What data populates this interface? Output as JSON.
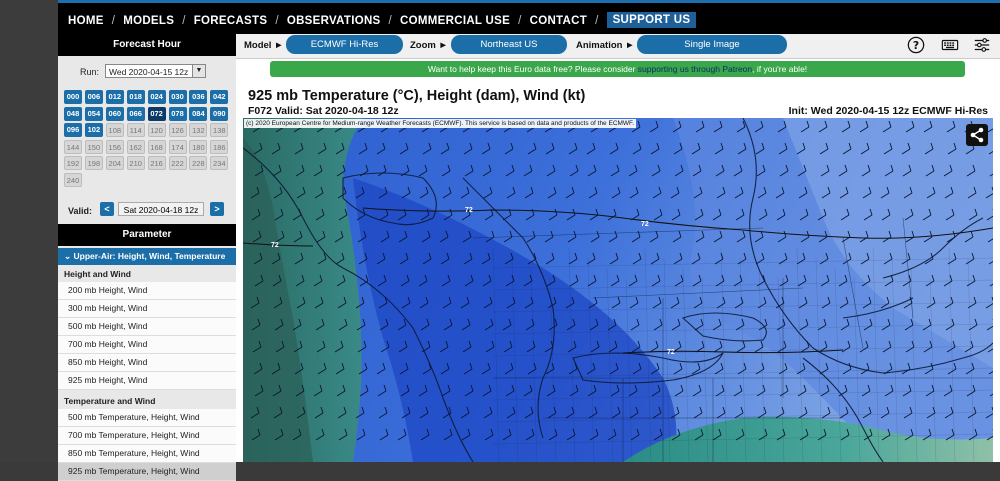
{
  "nav": {
    "items": [
      {
        "label": "HOME"
      },
      {
        "label": "MODELS"
      },
      {
        "label": "FORECASTS"
      },
      {
        "label": "OBSERVATIONS"
      },
      {
        "label": "COMMERCIAL USE"
      },
      {
        "label": "CONTACT"
      },
      {
        "label": "SUPPORT US",
        "active": true
      }
    ]
  },
  "sidebar": {
    "forecast_hour_title": "Forecast Hour",
    "run_label": "Run:",
    "run_value": "Wed 2020-04-15 12z",
    "hours": [
      {
        "h": "000",
        "s": "avail"
      },
      {
        "h": "006",
        "s": "avail"
      },
      {
        "h": "012",
        "s": "avail"
      },
      {
        "h": "018",
        "s": "avail"
      },
      {
        "h": "024",
        "s": "avail"
      },
      {
        "h": "030",
        "s": "avail"
      },
      {
        "h": "036",
        "s": "avail"
      },
      {
        "h": "042",
        "s": "avail"
      },
      {
        "h": "048",
        "s": "avail"
      },
      {
        "h": "054",
        "s": "avail"
      },
      {
        "h": "060",
        "s": "avail"
      },
      {
        "h": "066",
        "s": "avail"
      },
      {
        "h": "072",
        "s": "sel"
      },
      {
        "h": "078",
        "s": "avail"
      },
      {
        "h": "084",
        "s": "avail"
      },
      {
        "h": "090",
        "s": "avail"
      },
      {
        "h": "096",
        "s": "avail"
      },
      {
        "h": "102",
        "s": "avail"
      },
      {
        "h": "108",
        "s": "dis"
      },
      {
        "h": "114",
        "s": "dis"
      },
      {
        "h": "120",
        "s": "dis"
      },
      {
        "h": "126",
        "s": "dis"
      },
      {
        "h": "132",
        "s": "dis"
      },
      {
        "h": "138",
        "s": "dis"
      },
      {
        "h": "144",
        "s": "dis"
      },
      {
        "h": "150",
        "s": "dis"
      },
      {
        "h": "156",
        "s": "dis"
      },
      {
        "h": "162",
        "s": "dis"
      },
      {
        "h": "168",
        "s": "dis"
      },
      {
        "h": "174",
        "s": "dis"
      },
      {
        "h": "180",
        "s": "dis"
      },
      {
        "h": "186",
        "s": "dis"
      },
      {
        "h": "192",
        "s": "dis"
      },
      {
        "h": "198",
        "s": "dis"
      },
      {
        "h": "204",
        "s": "dis"
      },
      {
        "h": "210",
        "s": "dis"
      },
      {
        "h": "216",
        "s": "dis"
      },
      {
        "h": "222",
        "s": "dis"
      },
      {
        "h": "228",
        "s": "dis"
      },
      {
        "h": "234",
        "s": "dis"
      },
      {
        "h": "240",
        "s": "dis"
      }
    ],
    "valid_label": "Valid:",
    "prev_label": "<",
    "next_label": ">",
    "valid_value": "Sat 2020-04-18 12z",
    "parameter_title": "Parameter",
    "selected_category": "Upper-Air: Height, Wind, Temperature",
    "groups": [
      {
        "title": "Height and Wind",
        "items": [
          "200 mb Height, Wind",
          "300 mb Height, Wind",
          "500 mb Height, Wind",
          "700 mb Height, Wind",
          "850 mb Height, Wind",
          "925 mb Height, Wind"
        ]
      },
      {
        "title": "Temperature and Wind",
        "items": [
          "500 mb Temperature, Height, Wind",
          "700 mb Temperature, Height, Wind",
          "850 mb Temperature, Height, Wind",
          "925 mb Temperature, Height, Wind"
        ]
      }
    ],
    "current_item": "925 mb Temperature, Height, Wind"
  },
  "toolbar": {
    "model_label": "Model ►",
    "model_value": "ECMWF Hi-Res",
    "zoom_label": "Zoom ►",
    "zoom_value": "Northeast US",
    "animation_label": "Animation ►",
    "animation_value": "Single Image",
    "icons": [
      "help-icon",
      "keyboard-icon",
      "settings-icon"
    ]
  },
  "banner": {
    "text_before": "Want to help keep this Euro data free? Please consider ",
    "link_text": "supporting us through Patreon",
    "text_after": ", if you're able!"
  },
  "map": {
    "title": "925 mb Temperature (°C), Height (dam), Wind (kt)",
    "subtitle": "F072 Valid: Sat 2020-04-18 12z",
    "init": "Init: Wed 2020-04-15 12z ECMWF Hi-Res",
    "copyright": "(c) 2020 European Centre for Medium-range Weather Forecasts (ECMWF). This service is based on data and products of the ECMWF.",
    "contour_labels": [
      "72",
      "72",
      "72",
      "72"
    ],
    "colors": {
      "deep": "#1f4fc9",
      "mid": "#3a6ed8",
      "light": "#6f98e3",
      "teal": "#2f7a6e"
    }
  }
}
